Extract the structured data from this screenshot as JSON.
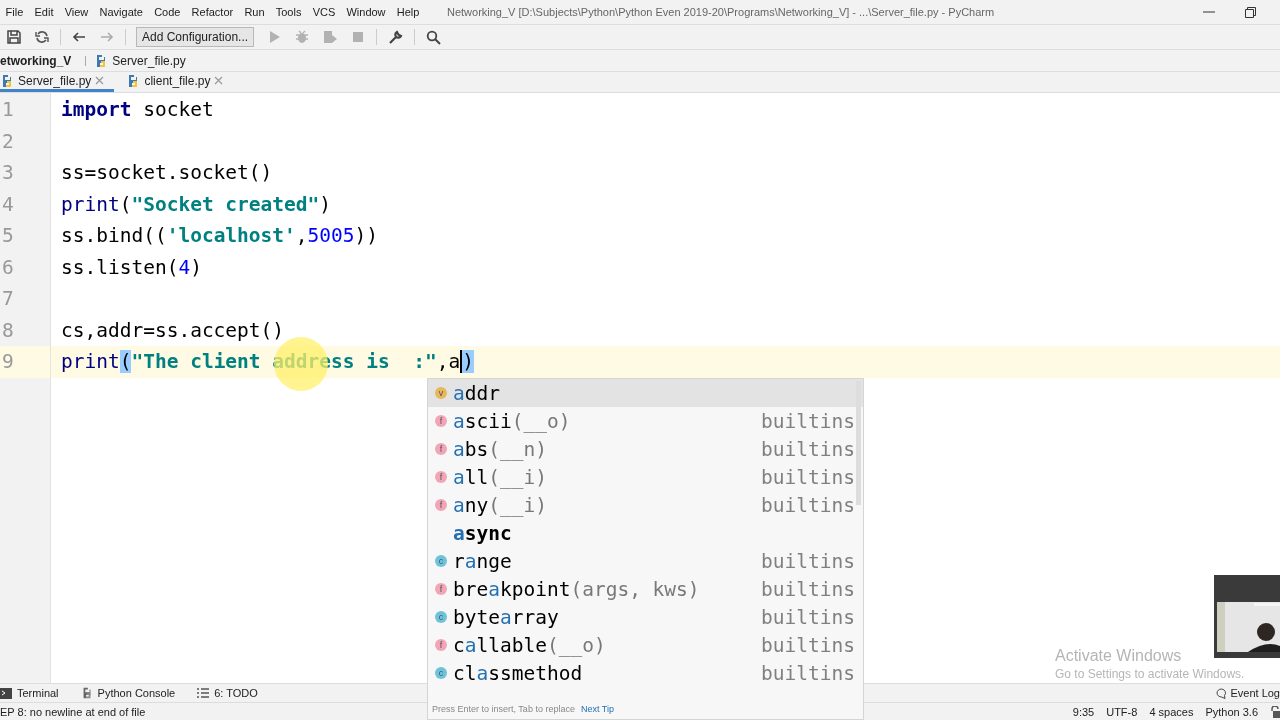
{
  "menu": [
    {
      "label": "File"
    },
    {
      "label": "Edit"
    },
    {
      "label": "View"
    },
    {
      "label": "Navigate"
    },
    {
      "label": "Code"
    },
    {
      "label": "Refactor"
    },
    {
      "label": "Run"
    },
    {
      "label": "Tools"
    },
    {
      "label": "VCS"
    },
    {
      "label": "Window"
    },
    {
      "label": "Help"
    }
  ],
  "window": {
    "title": "Networking_V [D:\\Subjects\\Python\\Python Even 2019-20\\Programs\\Networking_V] - ...\\Server_file.py - PyCharm"
  },
  "toolbar": {
    "left": [
      {
        "kind": "save",
        "disabled": false
      },
      {
        "kind": "sync",
        "disabled": false
      },
      {
        "kind": "back",
        "disabled": false
      },
      {
        "kind": "forward",
        "disabled": true
      }
    ],
    "config_button": "Add Configuration...",
    "right": [
      {
        "kind": "run",
        "disabled": true
      },
      {
        "kind": "debug",
        "disabled": true
      },
      {
        "kind": "coverage",
        "disabled": true
      },
      {
        "kind": "stop",
        "disabled": true
      },
      {
        "kind": "wrench",
        "disabled": false
      },
      {
        "kind": "search",
        "disabled": false
      }
    ]
  },
  "breadcrumb": [
    {
      "label": "etworking_V",
      "kind": "project"
    },
    {
      "label": "Server_file.py",
      "kind": "file"
    }
  ],
  "tabs": [
    {
      "label": "Server_file.py",
      "selected": true
    },
    {
      "label": "client_file.py",
      "selected": false
    }
  ],
  "editor": {
    "lines": [
      {
        "number": "1",
        "current": false,
        "tokens": [
          {
            "text": "import",
            "kind": "keyword"
          },
          {
            "text": " socket",
            "kind": "plain"
          }
        ]
      },
      {
        "number": "2",
        "current": false
      },
      {
        "number": "3",
        "current": false,
        "tokens": [
          {
            "text": "ss=socket.socket()",
            "kind": "plain"
          }
        ]
      },
      {
        "number": "4",
        "current": false,
        "tokens": [
          {
            "text": "print",
            "kind": "builtin"
          },
          {
            "text": "(",
            "kind": "plain"
          },
          {
            "text": "\"Socket created\"",
            "kind": "string"
          },
          {
            "text": ")",
            "kind": "plain"
          }
        ]
      },
      {
        "number": "5",
        "current": false,
        "tokens": [
          {
            "text": "ss.bind((",
            "kind": "plain"
          },
          {
            "text": "'localhost'",
            "kind": "string"
          },
          {
            "text": ",",
            "kind": "plain"
          },
          {
            "text": "5005",
            "kind": "number"
          },
          {
            "text": "))",
            "kind": "plain"
          }
        ]
      },
      {
        "number": "6",
        "current": false,
        "tokens": [
          {
            "text": "ss.listen(",
            "kind": "plain"
          },
          {
            "text": "4",
            "kind": "number"
          },
          {
            "text": ")",
            "kind": "plain"
          }
        ]
      },
      {
        "number": "7",
        "current": false
      },
      {
        "number": "8",
        "current": false,
        "tokens": [
          {
            "text": "cs,addr=ss.accept()",
            "kind": "plain"
          }
        ]
      },
      {
        "number": "9",
        "current": true,
        "tokens": [
          {
            "text": "print",
            "kind": "builtin"
          },
          {
            "text": "(",
            "kind": "bracket-match"
          },
          {
            "text": "\"The client address is  :\"",
            "kind": "string"
          },
          {
            "text": ",",
            "kind": "plain"
          },
          {
            "text": "a",
            "kind": "plain",
            "caret": true
          },
          {
            "text": ")",
            "kind": "bracket-match"
          }
        ]
      }
    ]
  },
  "completion": {
    "items": [
      {
        "kind": "variable",
        "badge": "v",
        "match": "a",
        "after": "ddr",
        "selected": true
      },
      {
        "kind": "function",
        "badge": "f",
        "match": "a",
        "after": "scii",
        "args": "(__o)",
        "source": "builtins",
        "selected": false
      },
      {
        "kind": "function",
        "badge": "f",
        "match": "a",
        "after": "bs",
        "args": "(__n)",
        "source": "builtins",
        "selected": false
      },
      {
        "kind": "function",
        "badge": "f",
        "match": "a",
        "after": "ll",
        "args": "(__i)",
        "source": "builtins",
        "selected": false
      },
      {
        "kind": "function",
        "badge": "f",
        "match": "a",
        "after": "ny",
        "args": "(__i)",
        "source": "builtins",
        "selected": false
      },
      {
        "kind": "keyword",
        "match": "a",
        "after": "sync",
        "selected": false
      },
      {
        "kind": "class",
        "badge": "c",
        "before": "r",
        "match": "a",
        "after": "nge",
        "source": "builtins",
        "selected": false
      },
      {
        "kind": "function",
        "badge": "f",
        "before": "bre",
        "match": "a",
        "after": "kpoint",
        "args": "(args, kws)",
        "source": "builtins",
        "selected": false
      },
      {
        "kind": "class",
        "badge": "c",
        "before": "byte",
        "match": "a",
        "after": "rray",
        "source": "builtins",
        "selected": false
      },
      {
        "kind": "function",
        "badge": "f",
        "before": "c",
        "match": "a",
        "after": "llable",
        "args": "(__o)",
        "source": "builtins",
        "selected": false
      },
      {
        "kind": "class",
        "badge": "c",
        "before": "cl",
        "match": "a",
        "after": "ssmethod",
        "source": "builtins",
        "selected": false
      }
    ],
    "hint": "Press Enter to insert, Tab to replace",
    "hint_link": "Next Tip"
  },
  "tool_windows": [
    {
      "label": "Terminal",
      "kind": "terminal"
    },
    {
      "label": "Python Console",
      "kind": "python"
    },
    {
      "label": "6: TODO",
      "kind": "todo"
    }
  ],
  "event_log": "Event Log",
  "status": {
    "message": "EP 8: no newline at end of file",
    "position": "9:35",
    "encoding": "UTF-8",
    "indent": "4 spaces",
    "interpreter": "Python 3.6"
  },
  "activation": {
    "title": "Activate Windows",
    "subtitle": "Go to Settings to activate Windows."
  }
}
